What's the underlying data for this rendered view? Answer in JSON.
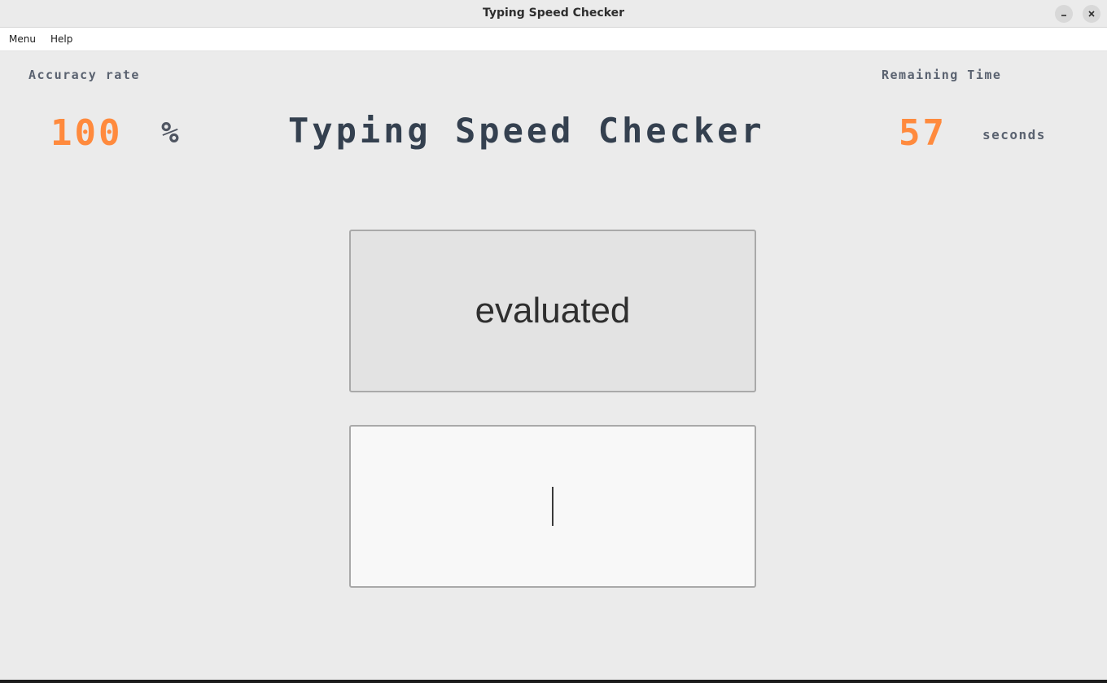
{
  "window": {
    "title": "Typing Speed Checker",
    "buttons": {
      "minimize_glyph": "–",
      "close_glyph": "✕"
    }
  },
  "menubar": {
    "items": [
      {
        "label": "Menu"
      },
      {
        "label": "Help"
      }
    ]
  },
  "stats": {
    "accuracy_label": "Accuracy rate",
    "accuracy_value": "100",
    "accuracy_unit": "%",
    "time_label": "Remaining Time",
    "time_value": "57",
    "time_unit": "seconds"
  },
  "main": {
    "heading": "Typing Speed Checker",
    "current_word": "evaluated",
    "typed_text": ""
  },
  "colors": {
    "accent_orange": "#ff8a3d",
    "heading": "#34404f",
    "background": "#ebebeb"
  }
}
